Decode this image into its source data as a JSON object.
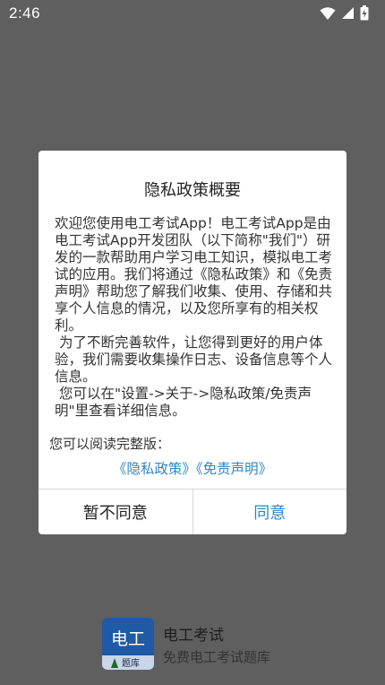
{
  "status_bar": {
    "time": "2:46",
    "icons": [
      "wifi-icon",
      "cellular-signal-icon",
      "battery-charging-icon"
    ]
  },
  "dialog": {
    "title": "隐私政策概要",
    "paragraphs": [
      "欢迎您使用电工考试App！电工考试App是由电工考试App开发团队（以下简称\"我们\"）研发的一款帮助用户学习电工知识，模拟电工考试的应用。我们将通过《隐私政策》和《免责声明》帮助您了解我们收集、使用、存储和共享个人信息的情况，以及您所享有的相关权利。",
      " 为了不断完善软件，让您得到更好的用户体验，我们需要收集操作日志、设备信息等个人信息。",
      " 您可以在\"设置->关于->隐私政策/免责声明\"里查看详细信息。"
    ],
    "read_full_label": "您可以阅读完整版：",
    "privacy_link": "《隐私政策》",
    "disclaimer_link": "《免责声明》",
    "disagree_button": "暂不同意",
    "agree_button": "同意"
  },
  "app": {
    "icon_text": "电工",
    "icon_subtext": "题库",
    "name": "电工考试",
    "subtitle": "免费电工考试题库"
  },
  "colors": {
    "overlay_bg": "#5f5f5f",
    "link_blue": "#2f86c8",
    "app_icon_blue": "#1f5aa6"
  }
}
